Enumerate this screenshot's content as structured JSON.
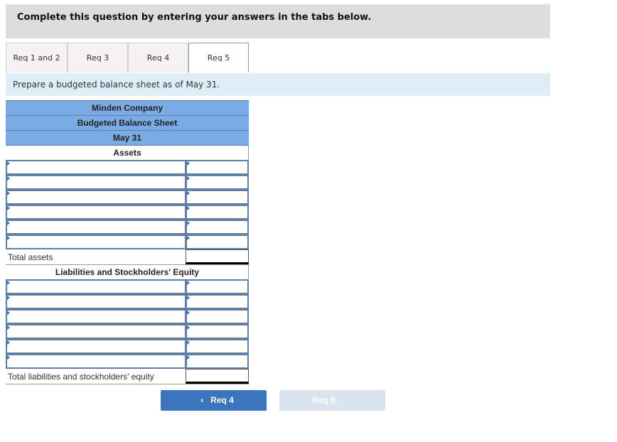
{
  "header": {
    "instruction": "Complete this question by entering your answers in the tabs below."
  },
  "tabs": [
    {
      "label": "Req 1 and 2",
      "active": false
    },
    {
      "label": "Req 3",
      "active": false
    },
    {
      "label": "Req 4",
      "active": false
    },
    {
      "label": "Req 5",
      "active": true
    }
  ],
  "prompt": "Prepare a budgeted balance sheet as of May 31.",
  "sheet": {
    "company": "Minden Company",
    "title": "Budgeted Balance Sheet",
    "date": "May 31",
    "assets_heading": "Assets",
    "total_assets_label": "Total assets",
    "liabilities_heading": "Liabilities and Stockholders' Equity",
    "total_liabilities_label": "Total liabilities and stockholders' equity"
  },
  "nav": {
    "prev_label": "Req 4",
    "next_label": "Req 5",
    "prev_icon": "‹",
    "next_icon": "›"
  }
}
